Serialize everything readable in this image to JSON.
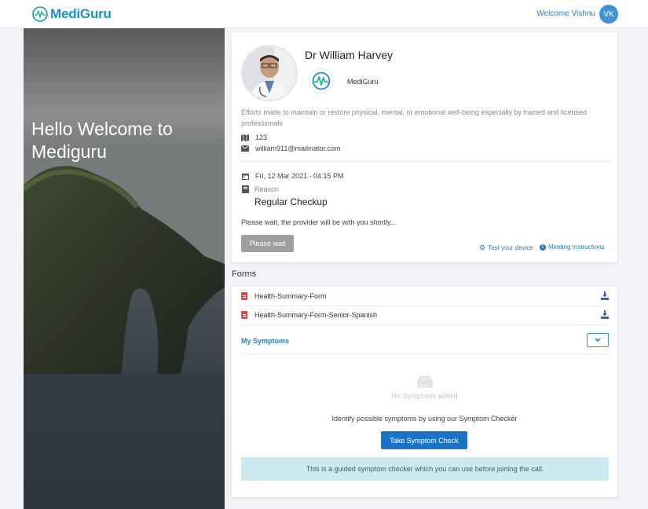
{
  "header": {
    "brand": "MediGuru",
    "welcome_text": "Welcome Vishnu",
    "avatar_initials": "VK"
  },
  "hero": {
    "title": "Hello Welcome to Mediguru"
  },
  "doctor": {
    "name": "Dr William Harvey",
    "organization": "MediGuru",
    "description": "Efforts made to maintain or restore physical, mental, or emotional well-being especially by trained and licensed professionals",
    "id_value": "123",
    "email": "william911@mailinator.com"
  },
  "appointment": {
    "datetime": "Fri, 12 Mar 2021 - 04:15 PM",
    "reason_label": "Reason",
    "reason_value": "Regular Checkup",
    "wait_message": "Please wait, the provider will be with you shortly...",
    "wait_button": "Please wait",
    "test_device_link": "Test your device",
    "meeting_instructions_link": "Meeting Instructions"
  },
  "forms": {
    "title": "Forms",
    "items": [
      {
        "label": "Health-Summary-Form"
      },
      {
        "label": "Health-Summary-Form-Senior-Spanish"
      }
    ]
  },
  "symptoms": {
    "title": "My Symptoms",
    "empty_text": "No Symptoms added",
    "identify_text": "Identify possible symptoms by using our Symptom Checker",
    "check_button": "Take Symptom Check",
    "guided_text": "This is a guided symptom checker which you can use before joining the call."
  },
  "colors": {
    "brand": "#1a8fd0",
    "link": "#1f7fc1",
    "primary_button": "#1a73c9",
    "disabled_button": "#9e9e9e",
    "info_box": "#cdeaf0"
  }
}
